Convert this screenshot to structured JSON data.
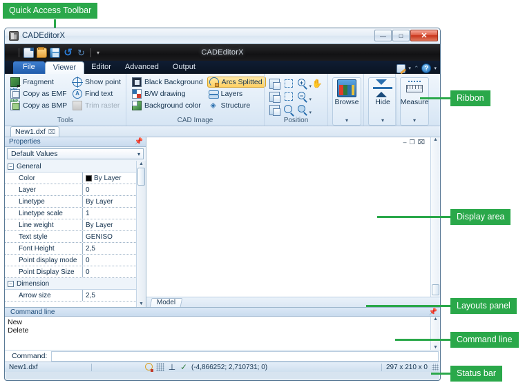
{
  "annotations": [
    {
      "id": "quick-access-toolbar",
      "label": "Quick Access Toolbar"
    },
    {
      "id": "ribbon",
      "label": "Ribbon"
    },
    {
      "id": "display-area",
      "label": "Display area"
    },
    {
      "id": "layouts-panel",
      "label": "Layouts panel"
    },
    {
      "id": "command-line",
      "label": "Command line"
    },
    {
      "id": "status-bar",
      "label": "Status bar"
    }
  ],
  "window": {
    "title": "CADEditorX",
    "brand": "CADEditorX",
    "controls": {
      "minimize": "—",
      "maximize": "□",
      "close": "✕"
    }
  },
  "quick_access": {
    "items": [
      {
        "name": "new",
        "tooltip": "New"
      },
      {
        "name": "open",
        "tooltip": "Open"
      },
      {
        "name": "save",
        "tooltip": "Save"
      },
      {
        "name": "undo",
        "glyph": "↺"
      },
      {
        "name": "redo",
        "glyph": "↻"
      }
    ],
    "more_caret": "▾"
  },
  "ribbon": {
    "tabs": [
      {
        "label": "File",
        "type": "file",
        "active": false
      },
      {
        "label": "Viewer",
        "type": "normal",
        "active": true
      },
      {
        "label": "Editor",
        "type": "normal",
        "active": false
      },
      {
        "label": "Advanced",
        "type": "normal",
        "active": false
      },
      {
        "label": "Output",
        "type": "normal",
        "active": false
      }
    ],
    "right_controls": [
      {
        "name": "edit-style",
        "caret": "▾"
      },
      {
        "name": "collapse-ribbon",
        "glyph": "⌃"
      },
      {
        "name": "help",
        "glyph": "?",
        "caret": "▾"
      }
    ],
    "groups": [
      {
        "name": "tools",
        "label": "Tools",
        "columns": [
          {
            "items": [
              {
                "label": "Fragment",
                "icon": "fragment-icon",
                "state": "normal"
              },
              {
                "label": "Copy as EMF",
                "icon": "copy-emf-icon",
                "state": "normal"
              },
              {
                "label": "Copy as BMP",
                "icon": "copy-bmp-icon",
                "state": "normal"
              }
            ]
          },
          {
            "items": [
              {
                "label": "Show point",
                "icon": "show-point-icon",
                "state": "normal"
              },
              {
                "label": "Find text",
                "icon": "find-text-icon",
                "state": "normal"
              },
              {
                "label": "Trim raster",
                "icon": "trim-raster-icon",
                "state": "disabled"
              }
            ]
          }
        ]
      },
      {
        "name": "cad-image",
        "label": "CAD Image",
        "columns": [
          {
            "items": [
              {
                "label": "Black Background",
                "icon": "black-background-icon",
                "state": "normal"
              },
              {
                "label": "B/W drawing",
                "icon": "bw-drawing-icon",
                "state": "normal"
              },
              {
                "label": "Background color",
                "icon": "background-color-icon",
                "state": "normal"
              }
            ]
          },
          {
            "items": [
              {
                "label": "Arcs Splitted",
                "icon": "arcs-splitted-icon",
                "state": "highlighted"
              },
              {
                "label": "Layers",
                "icon": "layers-icon",
                "state": "normal"
              },
              {
                "label": "Structure",
                "icon": "structure-icon",
                "state": "normal"
              }
            ]
          }
        ]
      },
      {
        "name": "position",
        "label": "Position",
        "tools": [
          {
            "name": "pan-window-icon",
            "caret": false
          },
          {
            "name": "zoom-window-icon",
            "caret": false
          },
          {
            "name": "zoom-in-icon",
            "caret": true
          },
          {
            "name": "pan-hand-icon",
            "caret": false
          },
          {
            "name": "copy-view-icon",
            "caret": false
          },
          {
            "name": "zoom-extents-icon",
            "caret": false
          },
          {
            "name": "zoom-out-icon",
            "caret": true
          },
          {
            "name": "spacer-icon",
            "caret": false
          },
          {
            "name": "rotate-icon",
            "caret": false
          },
          {
            "name": "zoom-previous-icon",
            "caret": false
          },
          {
            "name": "zoom-select-icon",
            "caret": true
          },
          {
            "name": "spacer2-icon",
            "caret": false
          }
        ]
      },
      {
        "name": "big-buttons",
        "buttons": [
          {
            "label": "Browse",
            "icon": "browse-icon",
            "caret": "▾"
          },
          {
            "label": "Hide",
            "icon": "hide-icon",
            "caret": "▾"
          },
          {
            "label": "Measure",
            "icon": "measure-icon",
            "caret": "▾"
          }
        ]
      }
    ]
  },
  "document_tabs": [
    {
      "label": "New1.dxf",
      "close": "⌧",
      "active": true
    }
  ],
  "properties": {
    "title": "Properties",
    "pin_icon": "pin-icon",
    "selector_value": "Default Values",
    "caret": "▾",
    "rows": [
      {
        "type": "group",
        "name": "General",
        "expander": "−"
      },
      {
        "type": "prop",
        "name": "Color",
        "value": "By Layer",
        "swatch": "#000000"
      },
      {
        "type": "prop",
        "name": "Layer",
        "value": "0"
      },
      {
        "type": "prop",
        "name": "Linetype",
        "value": "By Layer"
      },
      {
        "type": "prop",
        "name": "Linetype scale",
        "value": "1"
      },
      {
        "type": "prop",
        "name": "Line weight",
        "value": "By Layer"
      },
      {
        "type": "prop",
        "name": "Text style",
        "value": "GENISO"
      },
      {
        "type": "prop",
        "name": "Font Height",
        "value": "2,5"
      },
      {
        "type": "prop",
        "name": "Point display mode",
        "value": "0"
      },
      {
        "type": "prop",
        "name": "Point Display Size",
        "value": "0"
      },
      {
        "type": "group",
        "name": "Dimension",
        "expander": "−"
      },
      {
        "type": "prop",
        "name": "Arrow size",
        "value": "2,5"
      }
    ],
    "scroll_up": "▲",
    "scroll_down": "▼"
  },
  "canvas": {
    "mdi_controls": [
      {
        "name": "minimize-child-icon",
        "glyph": "–"
      },
      {
        "name": "restore-child-icon",
        "glyph": "❐"
      },
      {
        "name": "close-child-icon",
        "glyph": "⌧"
      }
    ],
    "quick_style_icon": "heart-icon",
    "scroll_up": "▲",
    "scroll_down": "▼"
  },
  "layouts": {
    "tabs": [
      {
        "label": "Model",
        "active": true
      }
    ]
  },
  "command_line": {
    "title": "Command line",
    "pin_icon": "pin-icon",
    "history": [
      "New",
      "Delete"
    ],
    "prompt_label": "Command:",
    "input_value": "",
    "scroll_up": "▲",
    "scroll_down": "▼"
  },
  "status_bar": {
    "file_name": "New1.dxf",
    "toggles": [
      {
        "name": "object-snap-icon"
      },
      {
        "name": "grid-snap-icon"
      },
      {
        "name": "ortho-icon"
      },
      {
        "name": "polar-tracking-icon"
      }
    ],
    "coordinates": "(-4,866252; 2,710731; 0)",
    "drawing_size": "297 x 210 x 0",
    "resize_grip": "resize-grip-icon"
  },
  "colors": {
    "annotation_green": "#2aa84a",
    "highlight_orange": "#ffd062",
    "ribbon_blue": "#1f5bab"
  }
}
